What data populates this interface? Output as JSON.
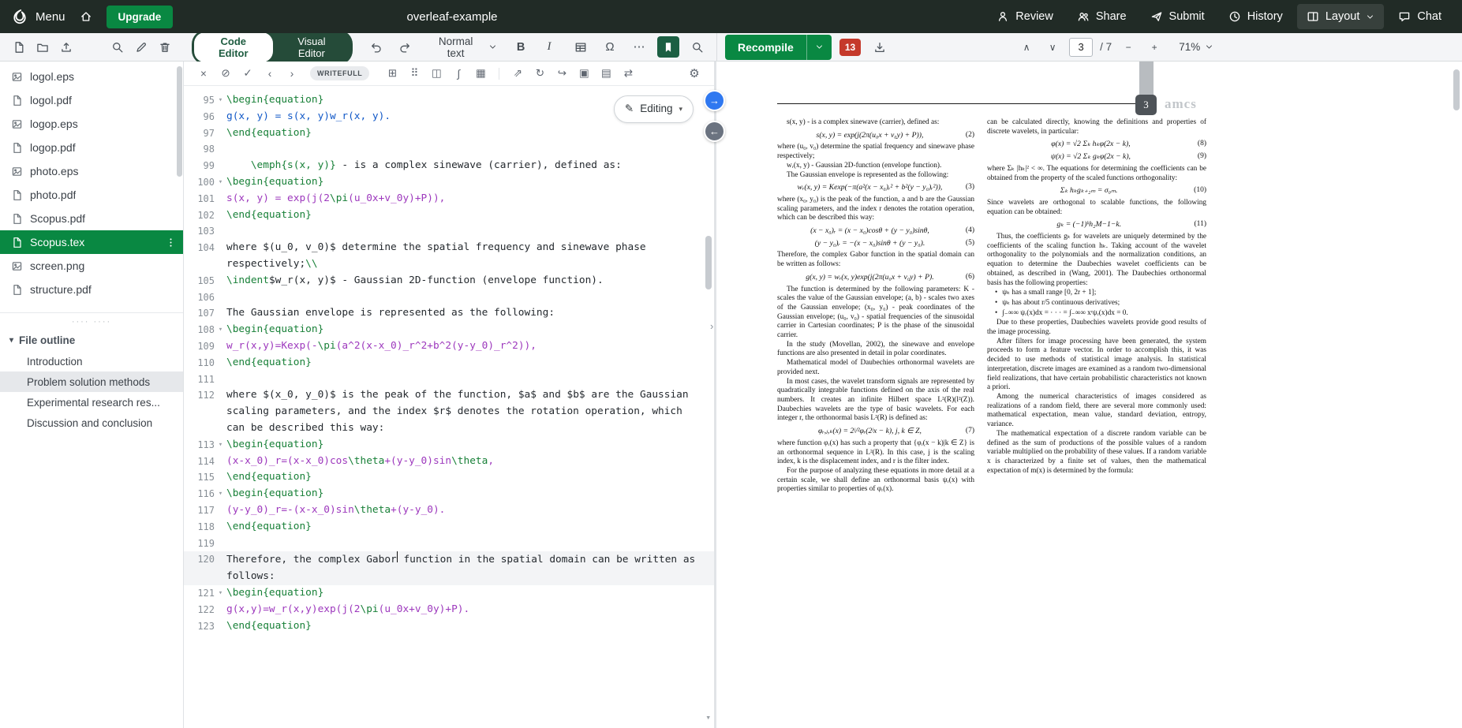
{
  "colors": {
    "header_bg": "#212b26",
    "accent_green": "#098842",
    "toggle_bg": "#254b39",
    "error_red": "#c5392b",
    "selected_file_bg": "#098842",
    "code_keyword": "#188038",
    "code_math_blue": "#1158c7",
    "code_math_purple": "#9d38bd"
  },
  "header": {
    "menu_label": "Menu",
    "upgrade_label": "Upgrade",
    "project_title": "overleaf-example",
    "actions": [
      {
        "name": "review-button",
        "icon": "person-icon",
        "label": "Review"
      },
      {
        "name": "share-button",
        "icon": "people-icon",
        "label": "Share"
      },
      {
        "name": "submit-button",
        "icon": "send-icon",
        "label": "Submit"
      },
      {
        "name": "history-button",
        "icon": "clock-icon",
        "label": "History"
      },
      {
        "name": "layout-button",
        "icon": "layout-grid-icon",
        "label": "Layout",
        "boxed": true,
        "caret": true
      },
      {
        "name": "chat-button",
        "icon": "chat-icon",
        "label": "Chat"
      }
    ]
  },
  "toolbar": {
    "file_actions": [
      {
        "name": "new-file-button",
        "icon": "new-file-icon"
      },
      {
        "name": "new-folder-button",
        "icon": "new-folder-icon"
      },
      {
        "name": "upload-file-button",
        "icon": "upload-icon"
      }
    ],
    "tree_actions": [
      {
        "name": "search-project-button",
        "icon": "search-icon"
      },
      {
        "name": "rename-file-button",
        "icon": "pencil-icon"
      },
      {
        "name": "delete-file-button",
        "icon": "trash-icon"
      }
    ],
    "code_editor": "Code Editor",
    "visual_editor": "Visual Editor",
    "paragraph_style": "Normal text",
    "bold": "B",
    "italic": "I",
    "editor_icons": [
      {
        "name": "insert-table-button",
        "icon": "insert-table-icon"
      },
      {
        "name": "symbol-palette-button",
        "glyph": "Ω"
      },
      {
        "name": "more-formatting-button",
        "glyph": "⋯"
      },
      {
        "name": "writefull-toggle-button",
        "icon": "bookmark-icon",
        "active": true
      },
      {
        "name": "search-in-file-button",
        "icon": "search-icon"
      }
    ],
    "recompile_label": "Recompile",
    "error_count": "13",
    "prev_page_glyph": "∧",
    "next_page_glyph": "∨",
    "page_current": "3",
    "page_total": "/ 7",
    "zoom_out_glyph": "−",
    "zoom_in_glyph": "+",
    "zoom": "71%"
  },
  "writefull": {
    "badge": "WRITEFULL",
    "group1": [
      {
        "name": "close-suggestions-button",
        "glyph": "×"
      },
      {
        "name": "disable-suggestions-button",
        "glyph": "⊘"
      },
      {
        "name": "accept-suggestion-button",
        "glyph": "✓"
      },
      {
        "name": "previous-suggestion-button",
        "glyph": "‹"
      },
      {
        "name": "next-suggestion-button",
        "glyph": "›"
      }
    ],
    "group2": [
      {
        "name": "table-cells-button",
        "glyph": "⊞"
      },
      {
        "name": "dots-grid-button",
        "glyph": "⠿"
      },
      {
        "name": "split-view-button",
        "glyph": "◫"
      },
      {
        "name": "equation-tools-button",
        "glyph": "∫"
      },
      {
        "name": "table-generator-button",
        "glyph": "▦"
      }
    ],
    "group3": [
      {
        "name": "share-selection-button",
        "glyph": "⇗"
      },
      {
        "name": "paraphrase-button",
        "glyph": "↻"
      },
      {
        "name": "forward-button",
        "glyph": "↪"
      },
      {
        "name": "copy-button",
        "glyph": "▣"
      },
      {
        "name": "document-check-button",
        "glyph": "▤"
      },
      {
        "name": "swap-button",
        "glyph": "⇄"
      }
    ],
    "settings_glyph": "⚙"
  },
  "file_tree": {
    "files": [
      {
        "name": "logol.eps",
        "icon": "image-file-icon"
      },
      {
        "name": "logol.pdf",
        "icon": "document-file-icon"
      },
      {
        "name": "logop.eps",
        "icon": "image-file-icon"
      },
      {
        "name": "logop.pdf",
        "icon": "document-file-icon"
      },
      {
        "name": "photo.eps",
        "icon": "image-file-icon"
      },
      {
        "name": "photo.pdf",
        "icon": "document-file-icon"
      },
      {
        "name": "Scopus.pdf",
        "icon": "document-file-icon"
      },
      {
        "name": "Scopus.tex",
        "icon": "document-file-icon",
        "selected": true
      },
      {
        "name": "screen.png",
        "icon": "image-file-icon"
      },
      {
        "name": "structure.pdf",
        "icon": "document-file-icon"
      }
    ],
    "outline_title": "File outline",
    "outline_caret": "▾",
    "outline": {
      "items": [
        {
          "label": "Introduction"
        },
        {
          "label": "Problem solution methods",
          "selected": true
        },
        {
          "label": "Experimental research res..."
        },
        {
          "label": "Discussion and conclusion"
        }
      ]
    }
  },
  "editor": {
    "editing_label": "Editing",
    "editing_caret": "▾",
    "editing_pencil": "✎",
    "fold_glyph": "▾",
    "scroll_hint": "▾",
    "lines": [
      {
        "no": 95,
        "fold": true,
        "seg": [
          [
            "k",
            "\\begin{equation}"
          ]
        ]
      },
      {
        "no": 96,
        "seg": [
          [
            "b",
            "g(x, y) = s(x, y)w_r(x, y)."
          ]
        ]
      },
      {
        "no": 97,
        "seg": [
          [
            "k",
            "\\end{equation}"
          ]
        ]
      },
      {
        "no": 98,
        "seg": []
      },
      {
        "no": 99,
        "seg": [
          [
            "n",
            "    "
          ],
          [
            "k",
            "\\emph{s(x, y)}"
          ],
          [
            "n",
            " - is a complex sinewave (carrier), defined as:"
          ]
        ]
      },
      {
        "no": 100,
        "fold": true,
        "seg": [
          [
            "k",
            "\\begin{equation}"
          ]
        ]
      },
      {
        "no": 101,
        "seg": [
          [
            "p",
            "s(x, y) = exp(j(2"
          ],
          [
            "k",
            "\\pi"
          ],
          [
            "p",
            "(u_0x+v_0y)+P)),"
          ]
        ]
      },
      {
        "no": 102,
        "seg": [
          [
            "k",
            "\\end{equation}"
          ]
        ]
      },
      {
        "no": 103,
        "seg": []
      },
      {
        "no": 104,
        "seg": [
          [
            "n",
            "where "
          ],
          [
            "d",
            "$(u_0, v_0)$"
          ],
          [
            "n",
            " determine the spatial frequency and sinewave phase respectively;"
          ],
          [
            "k",
            "\\\\"
          ]
        ]
      },
      {
        "no": 105,
        "seg": [
          [
            "k",
            "\\indent"
          ],
          [
            "d",
            "$w_r(x, y)$"
          ],
          [
            "n",
            " - Gaussian 2D-function (envelope function)."
          ]
        ]
      },
      {
        "no": 106,
        "seg": []
      },
      {
        "no": 107,
        "seg": [
          [
            "n",
            "The Gaussian envelope is represented as the following:"
          ]
        ]
      },
      {
        "no": 108,
        "fold": true,
        "seg": [
          [
            "k",
            "\\begin{equation}"
          ]
        ]
      },
      {
        "no": 109,
        "seg": [
          [
            "p",
            "w_r(x,y)=Kexp(-"
          ],
          [
            "k",
            "\\pi"
          ],
          [
            "p",
            "(a^2(x-x_0)_r^2+b^2(y-y_0)_r^2)),"
          ]
        ]
      },
      {
        "no": 110,
        "seg": [
          [
            "k",
            "\\end{equation}"
          ]
        ]
      },
      {
        "no": 111,
        "seg": []
      },
      {
        "no": 112,
        "seg": [
          [
            "n",
            "where "
          ],
          [
            "d",
            "$(x_0, y_0)$"
          ],
          [
            "n",
            " is the peak of the function, "
          ],
          [
            "d",
            "$a$"
          ],
          [
            "n",
            " and "
          ],
          [
            "d",
            "$b$"
          ],
          [
            "n",
            " are the Gaussian scaling parameters, and the index "
          ],
          [
            "d",
            "$r$"
          ],
          [
            "n",
            " denotes the rotation operation, which can be described this way:"
          ]
        ]
      },
      {
        "no": 113,
        "fold": true,
        "seg": [
          [
            "k",
            "\\begin{equation}"
          ]
        ]
      },
      {
        "no": 114,
        "seg": [
          [
            "p",
            "(x-x_0)_r=(x-x_0)cos"
          ],
          [
            "k",
            "\\theta"
          ],
          [
            "p",
            "+(y-y_0)sin"
          ],
          [
            "k",
            "\\theta"
          ],
          [
            "p",
            ","
          ]
        ]
      },
      {
        "no": 115,
        "seg": [
          [
            "k",
            "\\end{equation}"
          ]
        ]
      },
      {
        "no": 116,
        "fold": true,
        "seg": [
          [
            "k",
            "\\begin{equation}"
          ]
        ]
      },
      {
        "no": 117,
        "seg": [
          [
            "p",
            "(y-y_0)_r=-(x-x_0)sin"
          ],
          [
            "k",
            "\\theta"
          ],
          [
            "p",
            "+(y-y_0)."
          ]
        ]
      },
      {
        "no": 118,
        "seg": [
          [
            "k",
            "\\end{equation}"
          ]
        ]
      },
      {
        "no": 119,
        "seg": []
      },
      {
        "no": 120,
        "active": true,
        "seg": [
          [
            "n",
            "Therefore, the complex Gabor"
          ],
          [
            "c",
            ""
          ],
          [
            "n",
            " function in the spatial domain can be written as follows:"
          ]
        ]
      },
      {
        "no": 121,
        "fold": true,
        "seg": [
          [
            "k",
            "\\begin{equation}"
          ]
        ]
      },
      {
        "no": 122,
        "seg": [
          [
            "p",
            "g(x,y)=w_r(x,y)exp(j(2"
          ],
          [
            "k",
            "\\pi"
          ],
          [
            "p",
            "(u_0x+v_0y)+P)."
          ]
        ]
      },
      {
        "no": 123,
        "seg": [
          [
            "k",
            "\\end{equation}"
          ]
        ]
      }
    ]
  },
  "divider": {
    "to_pdf_arrow": "→",
    "to_code_arrow": "←",
    "chevron": "›"
  },
  "pdf": {
    "page_number": "3",
    "journal_logo": "amcs",
    "left_column": [
      {
        "type": "p",
        "indent": true,
        "text": "s(x, y) - is a complex sinewave (carrier), defined as:"
      },
      {
        "type": "eq",
        "text": "s(x, y) = exp(j(2π(u₀x + v₀y) + P)),",
        "num": "(2)"
      },
      {
        "type": "p",
        "text": "where (u₀, v₀) determine the spatial frequency and sinewave phase respectively;"
      },
      {
        "type": "p",
        "indent": true,
        "text": "wᵣ(x, y) - Gaussian 2D-function (envelope function)."
      },
      {
        "type": "p",
        "indent": true,
        "text": "The Gaussian envelope is represented as the following:"
      },
      {
        "type": "eq",
        "text": "wᵣ(x, y) = Kexp(−π(a²(x − x₀)ᵣ² + b²(y − y₀)ᵣ²)),",
        "num": "(3)"
      },
      {
        "type": "p",
        "text": "where (x₀, y₀) is the peak of the function, a and b are the Gaussian scaling parameters, and the index r denotes the rotation operation, which can be described this way:"
      },
      {
        "type": "eq",
        "text": "(x − x₀)ᵣ = (x − x₀)cosθ + (y − y₀)sinθ,",
        "num": "(4)"
      },
      {
        "type": "eq",
        "text": "(y − y₀)ᵣ = −(x − x₀)sinθ + (y − y₀).",
        "num": "(5)"
      },
      {
        "type": "p",
        "text": "Therefore, the complex Gabor function in the spatial domain can be written as follows:"
      },
      {
        "type": "eq",
        "text": "g(x, y) = wᵣ(x, y)exp(j(2π(u₀x + v₀y) + P).",
        "num": "(6)"
      },
      {
        "type": "p",
        "indent": true,
        "text": "The function is determined by the following parameters: K - scales the value of the Gaussian envelope; (a, b) - scales two axes of the Gaussian envelope; (x₀, y₀) - peak coordinates of the Gaussian envelope; (u₀, v₀) - spatial frequencies of the sinusoidal carrier in Cartesian coordinates; P is the phase of the sinusoidal carrier."
      },
      {
        "type": "p",
        "indent": true,
        "text": "In the study (Movellan, 2002), the sinewave and envelope functions are also presented in detail in polar coordinates."
      },
      {
        "type": "p",
        "indent": true,
        "text": "Mathematical model of Daubechies orthonormal wavelets are provided next."
      },
      {
        "type": "p",
        "indent": true,
        "text": "In most cases, the wavelet transform signals are represented by quadratically integrable functions defined on the axis of the real numbers. It creates an infinite Hilbert space L²(R)(l²(Z)). Daubechies wavelets are the type of basic wavelets. For each integer r, the orthonormal basis L²(R) is defined as:"
      },
      {
        "type": "eq",
        "text": "φᵣ,ⱼ,ₖ(x) = 2ʲ/²φᵣ(2ʲx − k), j, k ∈ Z,",
        "num": "(7)"
      },
      {
        "type": "p",
        "text": "where function φᵣ(x) has such a property that {φᵣ(x − k)|k ∈ Z} is an orthonormal sequence in L²(R). In this case, j is the scaling index, k is the displacement index, and r is the filter index."
      },
      {
        "type": "p",
        "indent": true,
        "text": "For the purpose of analyzing these equations in more detail at a certain scale, we shall define an orthonormal basis ψᵣ(x) with properties similar to properties of φᵣ(x)."
      }
    ],
    "right_column": [
      {
        "type": "p",
        "text": "can be calculated directly, knowing the definitions and properties of discrete wavelets, in particular:"
      },
      {
        "type": "eq",
        "text": "φ(x) = √2 Σₖ hₖφ(2x − k),",
        "num": "(8)"
      },
      {
        "type": "eq",
        "text": "ψ(x) = √2 Σₖ gₖφ(2x − k),",
        "num": "(9)"
      },
      {
        "type": "p",
        "text": "where Σₖ |hₖ|² < ∞. The equations for determining the coefficients can be obtained from the property of the scaled functions orthogonality:"
      },
      {
        "type": "eq",
        "text": "Σₖ hₖgₖ₊₂ₘ = σ₀ₘ.",
        "num": "(10)"
      },
      {
        "type": "p",
        "text": "Since wavelets are orthogonal to scalable functions, the following equation can be obtained:"
      },
      {
        "type": "eq",
        "text": "gₖ = (−1)ᵏh₂M−1−k.",
        "num": "(11)"
      },
      {
        "type": "p",
        "indent": true,
        "text": "Thus, the coefficients gₖ for wavelets are uniquely determined by the coefficients of the scaling function hₖ. Taking account of the wavelet orthogonality to the polynomials and the normalization conditions, an equation to determine the Daubechies wavelet coefficients can be obtained, as described in (Wang, 2001). The Daubechies orthonormal basis has the following properties:"
      },
      {
        "type": "bullet",
        "text": "ψₖ has a small range [0, 2r + 1];"
      },
      {
        "type": "bullet",
        "text": "ψₖ has about r/5 continuous derivatives;"
      },
      {
        "type": "bullet",
        "text": "∫₋∞∞ ψᵣ(x)dx = · · · = ∫₋∞∞ xʳψᵣ(x)dx = 0."
      },
      {
        "type": "p",
        "indent": true,
        "text": "Due to these properties, Daubechies wavelets provide good results of the image processing."
      },
      {
        "type": "p",
        "indent": true,
        "text": "After filters for image processing have been generated, the system proceeds to form a feature vector. In order to accomplish this, it was decided to use methods of statistical image analysis. In statistical interpretation, discrete images are examined as a random two-dimensional field realizations, that have certain probabilistic characteristics not known a priori."
      },
      {
        "type": "p",
        "indent": true,
        "text": "Among the numerical characteristics of images considered as realizations of a random field, there are several more commonly used: mathematical expectation, mean value, standard deviation, entropy, variance."
      },
      {
        "type": "p",
        "indent": true,
        "text": "The mathematical expectation of a discrete random variable can be defined as the sum of productions of the possible values of a random variable multiplied on the probability of these values. If a random variable x is characterized by a finite set of values, then the mathematical expectation of m(x) is determined by the formula:"
      }
    ]
  }
}
